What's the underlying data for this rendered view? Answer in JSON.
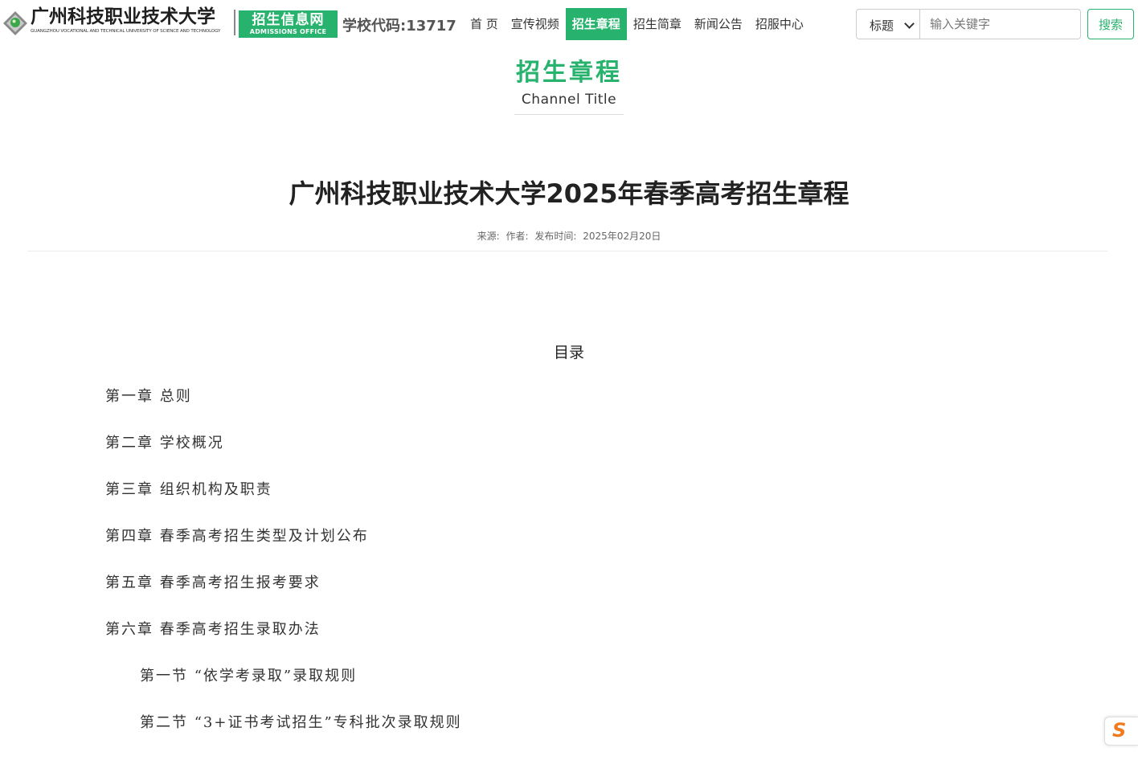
{
  "header": {
    "school_name_cn": "广州科技职业技术大学",
    "school_name_en": "GUANGZHOU VOCATIONAL AND TECHNICAL UNIVERSITY OF SCIENCE AND TECHNOLOGY",
    "office_cn": "招生信息网",
    "office_en": "ADMISSIONS OFFICE",
    "school_code": "学校代码:13717"
  },
  "nav": {
    "items": [
      {
        "label": "首 页"
      },
      {
        "label": "宣传视频"
      },
      {
        "label": "招生章程",
        "active": true
      },
      {
        "label": "招生简章"
      },
      {
        "label": "新闻公告"
      },
      {
        "label": "招服中心"
      }
    ]
  },
  "search": {
    "select_value": "标题",
    "placeholder": "输入关键字",
    "button_label": "搜索"
  },
  "channel": {
    "title_cn": "招生章程",
    "title_en": "Channel Title"
  },
  "article": {
    "title": "广州科技职业技术大学2025年春季高考招生章程",
    "source_label": "来源:",
    "author_label": "作者:",
    "date_label": "发布时间:",
    "date_value": "2025年02月20日"
  },
  "toc": {
    "heading": "目录",
    "items": [
      {
        "text": "第一章  总则",
        "level": 1
      },
      {
        "text": "第二章  学校概况",
        "level": 1
      },
      {
        "text": "第三章  组织机构及职责",
        "level": 1
      },
      {
        "text": "第四章  春季高考招生类型及计划公布",
        "level": 1
      },
      {
        "text": "第五章  春季高考招生报考要求",
        "level": 1
      },
      {
        "text": "第六章  春季高考招生录取办法",
        "level": 1
      },
      {
        "text": "第一节  “依学考录取”录取规则",
        "level": 2
      },
      {
        "text": "第二节  “3+证书考试招生”专科批次录取规则",
        "level": 2
      }
    ]
  },
  "colors": {
    "brand_green": "#27b26d",
    "widget_orange": "#f07a1c"
  },
  "widget": {
    "icon": "sogou-s-icon",
    "glyph": "S"
  }
}
